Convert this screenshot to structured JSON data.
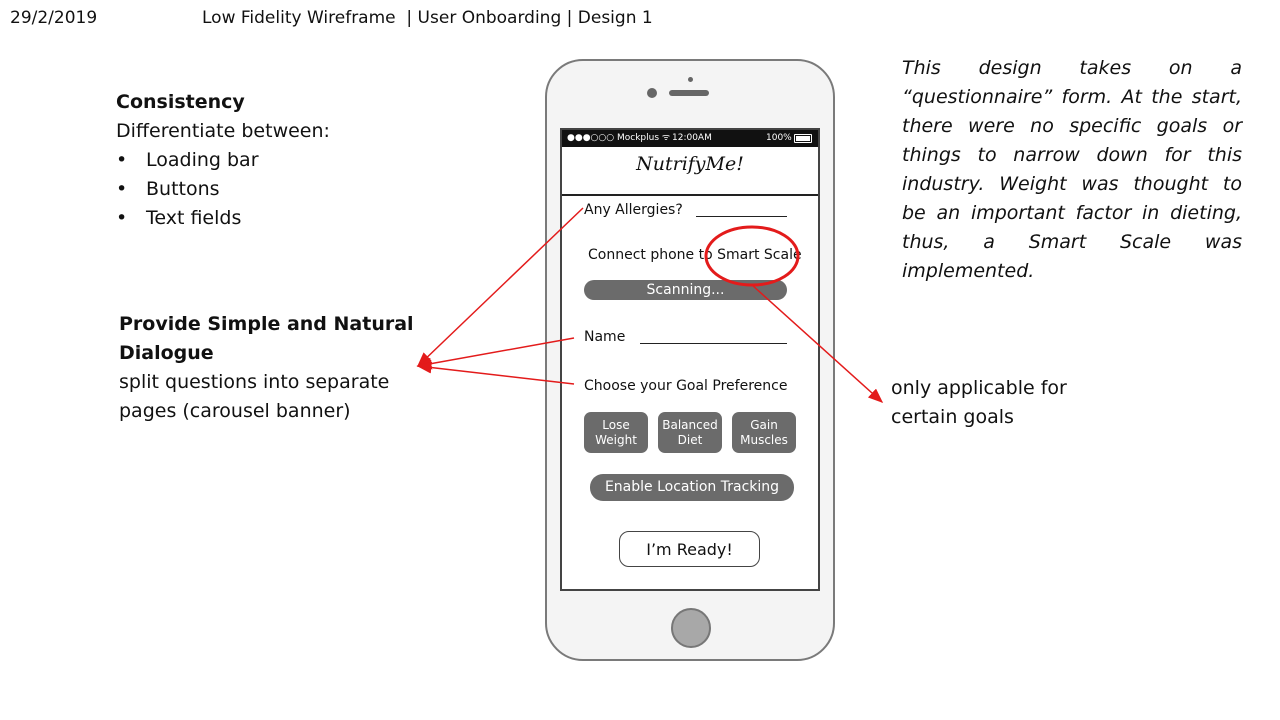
{
  "header": {
    "date": "29/2/2019",
    "title": "Low Fidelity Wireframe  | User Onboarding | Design 1"
  },
  "consistency": {
    "heading": "Consistency",
    "intro": "Differentiate between:",
    "items": [
      "Loading bar",
      "Buttons",
      "Text fields"
    ]
  },
  "dialogue": {
    "heading_line1": "Provide Simple and Natural",
    "heading_line2": "Dialogue",
    "body_line1": "split questions into separate",
    "body_line2": "pages (carousel banner)"
  },
  "design_note": {
    "lines": [
      "This design takes on a",
      "“questionnaire” form. At the start,",
      "there were no specific goals or",
      "things to narrow down for this",
      "industry. Weight was thought to",
      "be an important factor in dieting,",
      "thus, a Smart Scale was",
      "implemented."
    ]
  },
  "applicable_note": {
    "line1": "only applicable for",
    "line2": "certain goals"
  },
  "phone": {
    "status": {
      "carrier": "●●●○○○ Mockplus ᯤ",
      "time": "12:00AM",
      "battery": "100%"
    },
    "app_name": "NutrifyMe!",
    "allergies_label": "Any Allergies?",
    "connect_label": "Connect phone to Smart Scale",
    "scanning_label": "Scanning...",
    "name_label": "Name",
    "goal_label": "Choose your Goal Preference",
    "goal_buttons": [
      "Lose\nWeight",
      "Balanced\nDiet",
      "Gain\nMuscles"
    ],
    "location_button": "Enable Location Tracking",
    "ready_button": "I’m Ready!"
  },
  "colors": {
    "annotation": "#e31b1b",
    "button_gray": "#6b6b6b"
  }
}
